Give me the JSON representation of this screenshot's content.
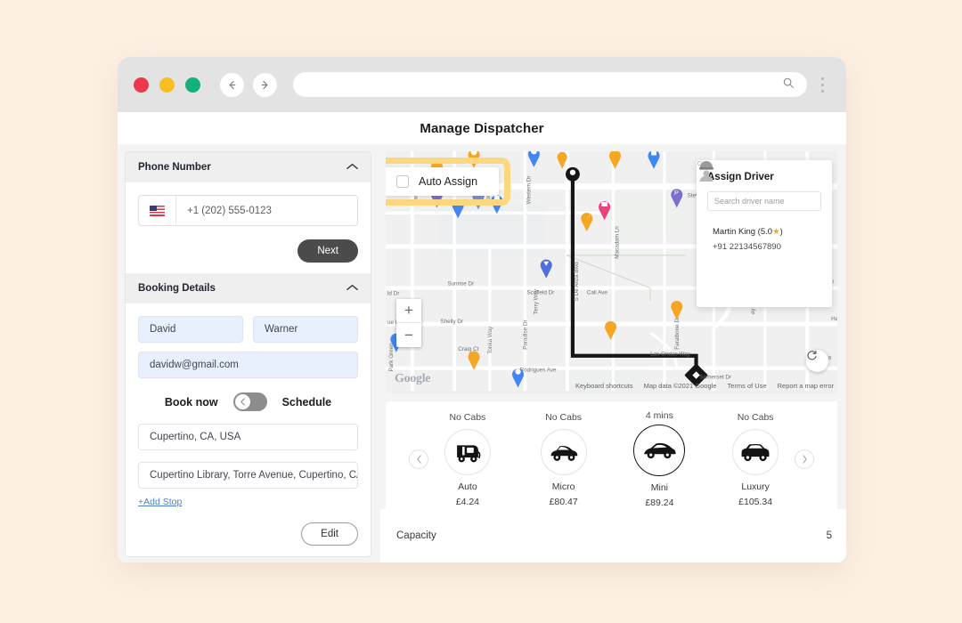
{
  "browser": {
    "url_value": "",
    "url_placeholder": "",
    "search_icon": "search-icon",
    "back_icon": "arrow-left-icon",
    "forward_icon": "arrow-right-icon",
    "menu_icon": "kebab-menu-icon",
    "lights": [
      "close-red",
      "minimize-yellow",
      "maximize-green"
    ]
  },
  "page": {
    "title": "Manage Dispatcher"
  },
  "phone_section": {
    "header": "Phone Number",
    "collapse_icon": "chevron-up-icon",
    "country_flag": "us-flag-icon",
    "value": "+1 (202) 555-0123",
    "next_label": "Next"
  },
  "booking_section": {
    "header": "Booking Details",
    "collapse_icon": "chevron-up-icon",
    "first_name": "David",
    "last_name": "Warner",
    "email": "davidw@gmail.com",
    "toggle_left_label": "Book now",
    "toggle_right_label": "Schedule",
    "toggle_state": "book-now",
    "pickup": "Cupertino, CA, USA",
    "dropoff": "Cupertino Library, Torre Avenue, Cupertino, CA, USA",
    "add_stop_label": "+Add Stop",
    "edit_label": "Edit"
  },
  "map": {
    "zoom_in": "+",
    "zoom_out": "−",
    "logo": "Google",
    "refresh_icon": "refresh-icon",
    "footer": [
      "Keyboard shortcuts",
      "Map data ©2021 Google",
      "Terms of Use",
      "Report a map error"
    ],
    "street_labels": [
      "Stevens C",
      "Scofield Dr",
      "Cali Ave",
      "S De Anza Blvd",
      "Macadam Ln",
      "Sunrise Dr",
      "Shelly Dr",
      "Craig Ct",
      "Western Dr",
      "Bonny Dr",
      "Barbara Ln",
      "Terry Way",
      "Tonka Way",
      "Paradise Dr",
      "Las Ondas Way",
      "Somerset Dr",
      "Rodrigues Ave",
      "Park Green",
      "Pri",
      "Ha",
      "La"
    ]
  },
  "auto_assign": {
    "label": "Auto Assign",
    "checked": false,
    "highlight_color": "#fbd77f"
  },
  "assign_driver": {
    "title": "Assign Driver",
    "search_placeholder": "Search driver name",
    "search_icon": "search-icon",
    "driver": {
      "avatar_icon": "driver-avatar-icon",
      "check_icon": "check-icon",
      "name": "Martin King (5.0",
      "rating_star": "★",
      "name_suffix": ")",
      "phone": "+91 22134567890"
    }
  },
  "vehicles": {
    "prev_icon": "chevron-left-icon",
    "next_icon": "chevron-right-icon",
    "items": [
      {
        "eta": "No Cabs",
        "name": "Auto",
        "price": "£4.24",
        "icon": "auto-rickshaw-icon",
        "selected": false
      },
      {
        "eta": "No Cabs",
        "name": "Micro",
        "price": "£80.47",
        "icon": "hatchback-car-icon",
        "selected": false
      },
      {
        "eta": "4 mins",
        "name": "Mini",
        "price": "£89.24",
        "icon": "sedan-car-icon",
        "selected": true
      },
      {
        "eta": "No Cabs",
        "name": "Luxury",
        "price": "£105.34",
        "icon": "suv-car-icon",
        "selected": false
      }
    ]
  },
  "capacity": {
    "label": "Capacity",
    "value": "5"
  }
}
